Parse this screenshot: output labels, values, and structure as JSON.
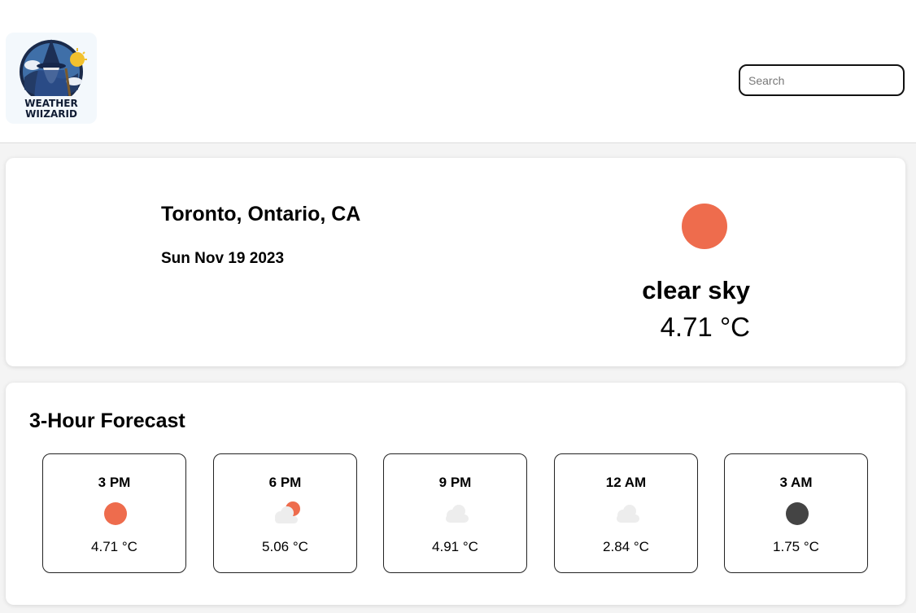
{
  "header": {
    "logo": {
      "alt": "Weather Wiizarid logo",
      "text_line1": "WEATHER",
      "text_line2": "WIIZARID"
    },
    "search": {
      "placeholder": "Search",
      "value": ""
    }
  },
  "current": {
    "location": "Toronto, Ontario, CA",
    "date": "Sun Nov 19 2023",
    "icon": "sun-icon",
    "condition": "clear sky",
    "temperature": "4.71 °C"
  },
  "forecast": {
    "title": "3-Hour Forecast",
    "items": [
      {
        "time": "3 PM",
        "icon": "sun-icon",
        "temp": "4.71 °C"
      },
      {
        "time": "6 PM",
        "icon": "sun-behind-cloud-icon",
        "temp": "5.06 °C"
      },
      {
        "time": "9 PM",
        "icon": "cloud-icon",
        "temp": "4.91 °C"
      },
      {
        "time": "12 AM",
        "icon": "cloud-icon",
        "temp": "2.84 °C"
      },
      {
        "time": "3 AM",
        "icon": "moon-icon",
        "temp": "1.75 °C"
      }
    ]
  },
  "colors": {
    "sun": "#ee6c4d",
    "cloud": "#ededed",
    "night": "#444444",
    "background": "#f4f4f4",
    "card": "#ffffff"
  }
}
